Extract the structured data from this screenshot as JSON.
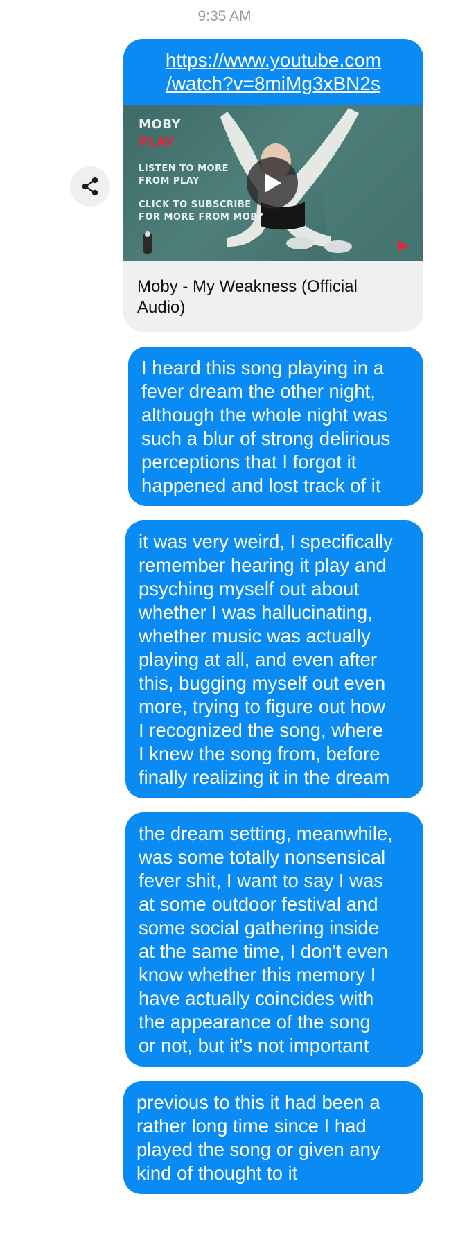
{
  "timestamp": "9:35 AM",
  "share_icon": "share-icon",
  "link_card": {
    "url_line1": "https://www.youtube.com",
    "url_line2": "/watch?v=8miMg3xBN2s",
    "thumbnail": {
      "artist": "MOBY",
      "album": "PLAY",
      "line1": "LISTEN TO MORE",
      "line2": "FROM PLAY",
      "line3": "CLICK TO SUBSCRIBE",
      "line4": "FOR MORE FROM MOBY",
      "play_icon": "play-icon"
    },
    "caption_line1": "Moby - My Weakness (Official",
    "caption_line2": "Audio)"
  },
  "messages": [
    {
      "lines": [
        "I heard this song playing in a",
        "fever dream the other night,",
        "although the whole night was",
        "such a blur of strong delirious",
        "perceptions that I forgot it",
        "happened and lost track of it"
      ]
    },
    {
      "lines": [
        "it was very weird, I specifically",
        "remember hearing it play and",
        "psyching myself out about",
        "whether I was hallucinating,",
        "whether music was actually",
        "playing at all, and even after",
        "this, bugging myself out even",
        "more, trying to figure out how",
        "I recognized the song, where",
        "I knew the song from, before",
        "finally realizing it in the dream"
      ]
    },
    {
      "lines": [
        "the dream setting, meanwhile,",
        "was some totally nonsensical",
        "fever shit, I want to say I was",
        "at some outdoor festival and",
        "some social gathering inside",
        "at the same time, I don't even",
        "know whether this memory I",
        "have actually coincides with",
        "the appearance of the song",
        "or not, but it's not important"
      ]
    },
    {
      "lines": [
        "previous to this it had been a",
        "rather long time since I had",
        "played the song or given any",
        "kind of thought to it"
      ]
    }
  ],
  "colors": {
    "bubble": "#0a8bf3",
    "card_background": "#f0f0f0",
    "timestamp": "#9a9a9a"
  }
}
